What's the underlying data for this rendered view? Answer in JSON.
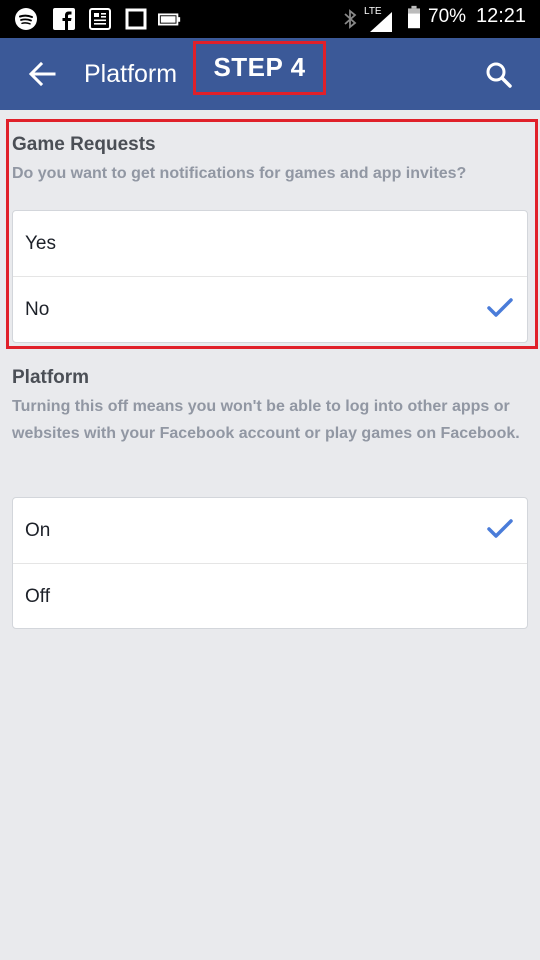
{
  "status_bar": {
    "icons": [
      "spotify-icon",
      "facebook-icon",
      "news-icon",
      "square-icon",
      "battery-small-icon",
      "bluetooth-icon",
      "lte-signal-icon",
      "battery-icon"
    ],
    "network": "LTE",
    "battery": "70%",
    "time": "12:21"
  },
  "app_bar": {
    "title": "Platform",
    "color": "#3b5998"
  },
  "annotation": {
    "step_label": "STEP 4",
    "highlight_color": "#e0202a"
  },
  "game_requests": {
    "title": "Game Requests",
    "description": "Do you want to get notifications for games and app invites?",
    "options": [
      {
        "label": "Yes",
        "selected": false
      },
      {
        "label": "No",
        "selected": true
      }
    ]
  },
  "platform": {
    "title": "Platform",
    "description": "Turning this off means you won't be able to log into other apps or websites with your Facebook account or play games on Facebook.",
    "options": [
      {
        "label": "On",
        "selected": true
      },
      {
        "label": "Off",
        "selected": false
      }
    ]
  },
  "accent_color": "#4a7cd9"
}
